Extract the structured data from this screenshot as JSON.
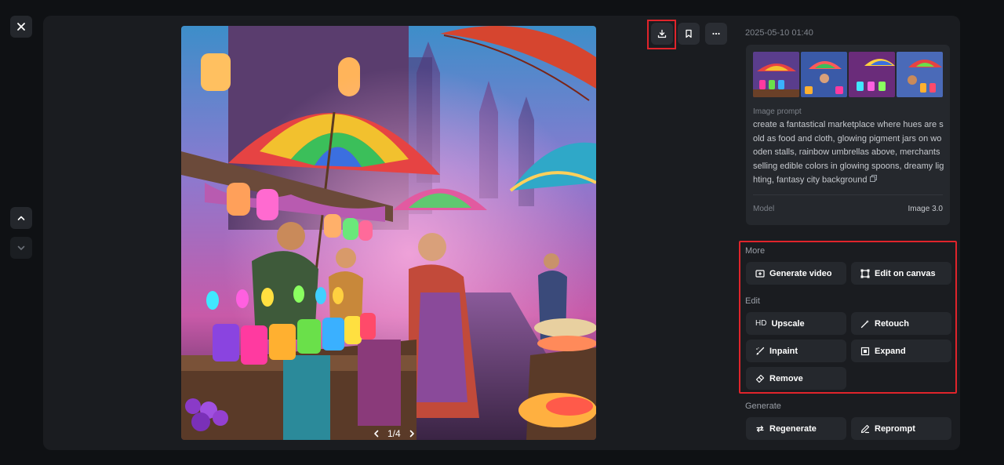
{
  "window": {
    "close_icon": "close-icon"
  },
  "nav": {
    "up_icon": "chevron-up-icon",
    "down_icon": "chevron-down-icon"
  },
  "image": {
    "pager": "1/4",
    "prev_icon": "chevron-left-icon",
    "next_icon": "chevron-right-icon"
  },
  "toolbar": {
    "download_icon": "download-icon",
    "bookmark_icon": "bookmark-icon",
    "more_icon": "more-horizontal-icon"
  },
  "details": {
    "timestamp": "2025-05-10 01:40",
    "prompt_label": "Image prompt",
    "prompt_text": "create a fantastical marketplace where hues are sold as food and cloth, glowing pigment jars on wooden stalls, rainbow umbrellas above, merchants selling edible colors in glowing spoons, dreamy lighting, fantasy city background",
    "model_label": "Model",
    "model_value": "Image 3.0"
  },
  "actions": {
    "more_label": "More",
    "generate_video": "Generate video",
    "edit_on_canvas": "Edit on canvas",
    "edit_label": "Edit",
    "upscale_prefix": "HD",
    "upscale": "Upscale",
    "retouch": "Retouch",
    "inpaint": "Inpaint",
    "expand": "Expand",
    "remove": "Remove",
    "generate_label": "Generate",
    "regenerate": "Regenerate",
    "reprompt": "Reprompt"
  },
  "colors": {
    "background": "#0f1114",
    "panel": "#1a1c20",
    "card": "#25282d",
    "highlight": "#e0242b"
  }
}
